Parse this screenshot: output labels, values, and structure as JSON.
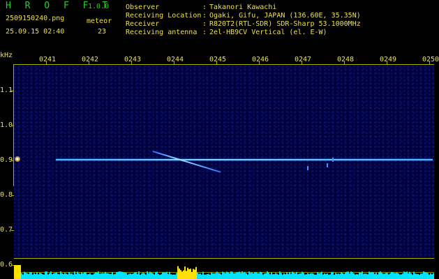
{
  "app": {
    "name": "H R O F F T",
    "version": "1.0.0"
  },
  "file": {
    "name": "2509150240.png",
    "datetime": "25.09.15 02:40"
  },
  "meteor": {
    "label": "meteor",
    "count": "23"
  },
  "info": [
    {
      "label": "Observer",
      "value": "Takanori Kawachi"
    },
    {
      "label": "Receiving Location",
      "value": "Ogaki, Gifu, JAPAN (136.60E, 35.35N)"
    },
    {
      "label": "Receiver",
      "value": "R820T2(RTL-SDR) SDR-Sharp 53.1000MHz"
    },
    {
      "label": "Receiving antenna",
      "value": "2el-HB9CV Vertical (el. E-W)"
    }
  ],
  "separator": ":",
  "axis": {
    "y_unit": "kHz",
    "x_ticks": [
      "0241",
      "0242",
      "0243",
      "0244",
      "0245",
      "0246",
      "0247",
      "0248",
      "0249",
      "0250"
    ],
    "y_ticks": [
      "1.1",
      "1.0",
      "0.9",
      "0.8",
      "0.7",
      "0.6"
    ]
  },
  "colors": {
    "label_green": "#21d321",
    "label_yellow": "#f0e14a",
    "background": "#00003a",
    "signal": "#4fb6ff",
    "spectrum": "#00e5ff",
    "spectrum_peak": "#ffe000"
  }
}
